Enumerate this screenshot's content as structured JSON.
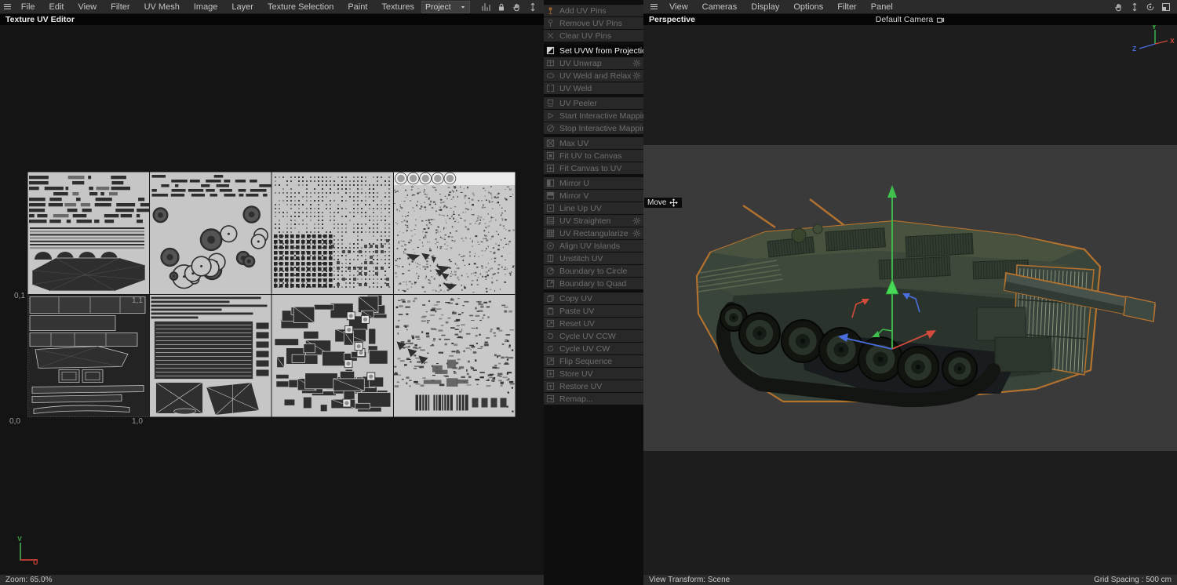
{
  "left": {
    "menus": [
      "File",
      "Edit",
      "View",
      "Filter",
      "UV Mesh",
      "Image",
      "Layer",
      "Texture Selection",
      "Paint",
      "Textures"
    ],
    "title": "Texture UV Editor",
    "project": "Project",
    "toolbar": [
      "histogram-icon",
      "lock-icon",
      "hand-icon",
      "pan-vertical-icon"
    ],
    "uv_corner_labels": {
      "top_left": "0,1",
      "top_right": "1,1",
      "bottom_left": "0,0",
      "bottom_right": "1,0"
    },
    "axis_v": "V",
    "axis_u": "U",
    "status": "Zoom: 65.0%"
  },
  "commands": {
    "groups": [
      {
        "items": [
          {
            "label": "Add UV Pins",
            "icon": "pin-icon",
            "accent": true
          },
          {
            "label": "Remove UV Pins",
            "icon": "pin-remove-icon"
          },
          {
            "label": "Clear UV Pins",
            "icon": "clear-icon"
          }
        ]
      },
      {
        "items": [
          {
            "label": "Set UVW from Projection",
            "icon": "projection-icon",
            "active": true,
            "gear": true
          },
          {
            "label": "UV Unwrap",
            "icon": "unwrap-icon",
            "gear": true
          },
          {
            "label": "UV Weld and Relax",
            "icon": "weld-relax-icon",
            "gear": true
          },
          {
            "label": "UV Weld",
            "icon": "weld-icon"
          }
        ]
      },
      {
        "items": [
          {
            "label": "UV Peeler",
            "icon": "peeler-icon"
          },
          {
            "label": "Start Interactive Mapping",
            "icon": "play-icon"
          },
          {
            "label": "Stop Interactive Mapping",
            "icon": "stop-icon"
          }
        ]
      },
      {
        "items": [
          {
            "label": "Max UV",
            "icon": "max-uv-icon"
          },
          {
            "label": "Fit UV to Canvas",
            "icon": "fit-uv-icon"
          },
          {
            "label": "Fit Canvas to UV",
            "icon": "fit-canvas-icon"
          }
        ]
      },
      {
        "items": [
          {
            "label": "Mirror U",
            "icon": "mirror-u-icon"
          },
          {
            "label": "Mirror V",
            "icon": "mirror-v-icon"
          },
          {
            "label": "Line Up UV",
            "icon": "line-up-icon"
          },
          {
            "label": "UV Straighten",
            "icon": "straighten-icon",
            "gear": true
          },
          {
            "label": "UV Rectangularize",
            "icon": "rectangularize-icon",
            "gear": true
          },
          {
            "label": "Align UV Islands",
            "icon": "align-icon"
          },
          {
            "label": "Unstitch UV",
            "icon": "unstitch-icon"
          },
          {
            "label": "Boundary to Circle",
            "icon": "boundary-circle-icon"
          },
          {
            "label": "Boundary to Quad",
            "icon": "boundary-quad-icon"
          }
        ]
      },
      {
        "items": [
          {
            "label": "Copy UV",
            "icon": "copy-icon"
          },
          {
            "label": "Paste UV",
            "icon": "paste-icon"
          },
          {
            "label": "Reset UV",
            "icon": "reset-icon"
          },
          {
            "label": "Cycle UV CCW",
            "icon": "cycle-ccw-icon"
          },
          {
            "label": "Cycle UV CW",
            "icon": "cycle-cw-icon"
          },
          {
            "label": "Flip Sequence",
            "icon": "flip-icon"
          },
          {
            "label": "Store UV",
            "icon": "store-icon"
          },
          {
            "label": "Restore UV",
            "icon": "restore-icon"
          },
          {
            "label": "Remap...",
            "icon": "remap-icon"
          }
        ]
      }
    ]
  },
  "right": {
    "menus": [
      "View",
      "Cameras",
      "Display",
      "Options",
      "Filter",
      "Panel"
    ],
    "toolbar": [
      "hand-icon",
      "pan-vertical-icon",
      "rotate-view-icon",
      "panel-layout-icon"
    ],
    "view_label": "Perspective",
    "camera_label": "Default Camera",
    "tool_chip": "Move",
    "axis": {
      "x": "X",
      "y": "Y",
      "z": "Z"
    },
    "status_left": "View Transform: Scene",
    "status_right": "Grid Spacing : 500 cm"
  },
  "colors": {
    "selection_orange": "#b4722f",
    "axis_x": "#d24b3c",
    "axis_y": "#3fc14c",
    "axis_z": "#4a6ee0",
    "uv_light": "#c6c6c6",
    "uv_dark": "#2e2e2e"
  }
}
